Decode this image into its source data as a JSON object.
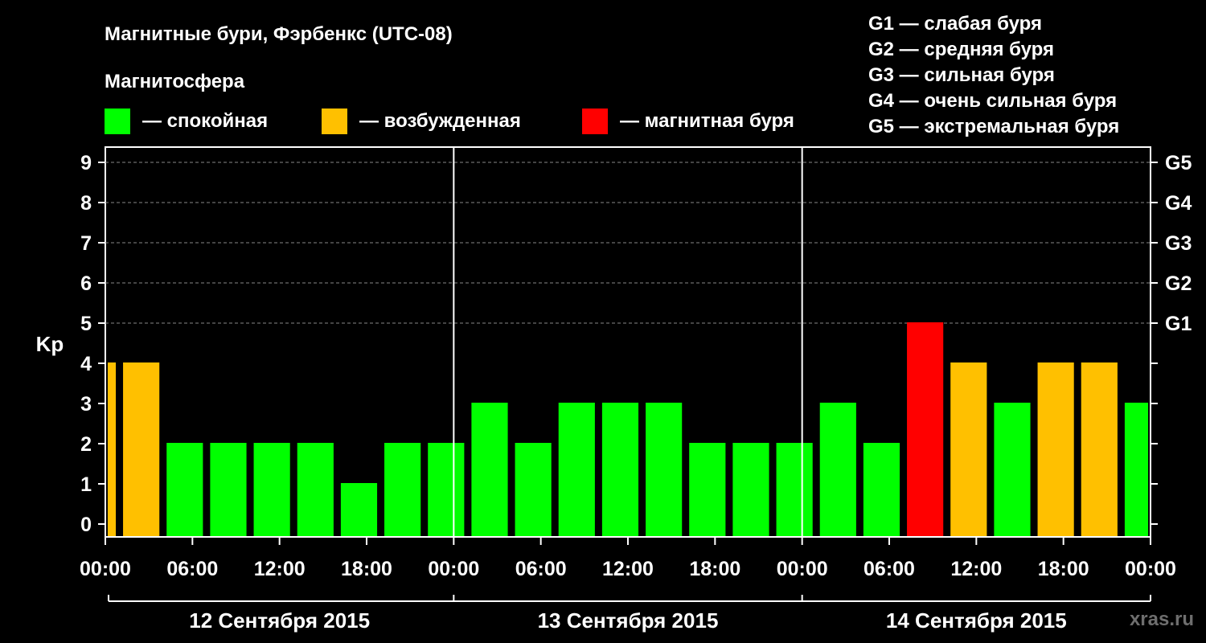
{
  "chart_data": {
    "type": "bar",
    "title": "Магнитные бури, Фэрбенкс (UTC-08)",
    "legend_heading": "Магнитосфера",
    "legend": [
      {
        "label": "— спокойная",
        "color": "#00ff00"
      },
      {
        "label": "— возбужденная",
        "color": "#ffc000"
      },
      {
        "label": "— магнитная буря",
        "color": "#ff0000"
      }
    ],
    "storm_scale": [
      "G1 — слабая буря",
      "G2 — средняя буря",
      "G3 — сильная буря",
      "G4 — очень сильная буря",
      "G5 — экстремальная буря"
    ],
    "ylabel": "Kp",
    "ylim": [
      0,
      9
    ],
    "y_ticks": [
      "0",
      "1",
      "2",
      "3",
      "4",
      "5",
      "6",
      "7",
      "8",
      "9"
    ],
    "right_ticks": [
      {
        "y": 5,
        "label": "G1"
      },
      {
        "y": 6,
        "label": "G2"
      },
      {
        "y": 7,
        "label": "G3"
      },
      {
        "y": 8,
        "label": "G4"
      },
      {
        "y": 9,
        "label": "G5"
      }
    ],
    "x_range_hours": [
      0,
      72
    ],
    "x_ticks": [
      {
        "h": 0,
        "label": "00:00"
      },
      {
        "h": 6,
        "label": "06:00"
      },
      {
        "h": 12,
        "label": "12:00"
      },
      {
        "h": 18,
        "label": "18:00"
      },
      {
        "h": 24,
        "label": "00:00"
      },
      {
        "h": 30,
        "label": "06:00"
      },
      {
        "h": 36,
        "label": "12:00"
      },
      {
        "h": 42,
        "label": "18:00"
      },
      {
        "h": 48,
        "label": "00:00"
      },
      {
        "h": 54,
        "label": "06:00"
      },
      {
        "h": 60,
        "label": "12:00"
      },
      {
        "h": 66,
        "label": "18:00"
      },
      {
        "h": 72,
        "label": "00:00"
      }
    ],
    "days": [
      {
        "label": "12 Сентября 2015",
        "start_h": 0,
        "end_h": 24
      },
      {
        "label": "13 Сентября 2015",
        "start_h": 24,
        "end_h": 48
      },
      {
        "label": "14 Сентября 2015",
        "start_h": 48,
        "end_h": 72
      }
    ],
    "grid": "dashed at Kp 5-9",
    "bars": [
      {
        "start_h": 0,
        "end_h": 1,
        "kp": 4,
        "color": "#ffc000"
      },
      {
        "start_h": 1,
        "end_h": 4,
        "kp": 4,
        "color": "#ffc000"
      },
      {
        "start_h": 4,
        "end_h": 7,
        "kp": 2,
        "color": "#00ff00"
      },
      {
        "start_h": 7,
        "end_h": 10,
        "kp": 2,
        "color": "#00ff00"
      },
      {
        "start_h": 10,
        "end_h": 13,
        "kp": 2,
        "color": "#00ff00"
      },
      {
        "start_h": 13,
        "end_h": 16,
        "kp": 2,
        "color": "#00ff00"
      },
      {
        "start_h": 16,
        "end_h": 19,
        "kp": 1,
        "color": "#00ff00"
      },
      {
        "start_h": 19,
        "end_h": 22,
        "kp": 2,
        "color": "#00ff00"
      },
      {
        "start_h": 22,
        "end_h": 25,
        "kp": 2,
        "color": "#00ff00"
      },
      {
        "start_h": 25,
        "end_h": 28,
        "kp": 3,
        "color": "#00ff00"
      },
      {
        "start_h": 28,
        "end_h": 31,
        "kp": 2,
        "color": "#00ff00"
      },
      {
        "start_h": 31,
        "end_h": 34,
        "kp": 3,
        "color": "#00ff00"
      },
      {
        "start_h": 34,
        "end_h": 37,
        "kp": 3,
        "color": "#00ff00"
      },
      {
        "start_h": 37,
        "end_h": 40,
        "kp": 3,
        "color": "#00ff00"
      },
      {
        "start_h": 40,
        "end_h": 43,
        "kp": 2,
        "color": "#00ff00"
      },
      {
        "start_h": 43,
        "end_h": 46,
        "kp": 2,
        "color": "#00ff00"
      },
      {
        "start_h": 46,
        "end_h": 49,
        "kp": 2,
        "color": "#00ff00"
      },
      {
        "start_h": 49,
        "end_h": 52,
        "kp": 3,
        "color": "#00ff00"
      },
      {
        "start_h": 52,
        "end_h": 55,
        "kp": 2,
        "color": "#00ff00"
      },
      {
        "start_h": 55,
        "end_h": 58,
        "kp": 5,
        "color": "#ff0000"
      },
      {
        "start_h": 58,
        "end_h": 61,
        "kp": 4,
        "color": "#ffc000"
      },
      {
        "start_h": 61,
        "end_h": 64,
        "kp": 3,
        "color": "#00ff00"
      },
      {
        "start_h": 64,
        "end_h": 67,
        "kp": 4,
        "color": "#ffc000"
      },
      {
        "start_h": 67,
        "end_h": 70,
        "kp": 4,
        "color": "#ffc000"
      },
      {
        "start_h": 70,
        "end_h": 72,
        "kp": 3,
        "color": "#00ff00"
      }
    ]
  },
  "watermark": "xras.ru"
}
